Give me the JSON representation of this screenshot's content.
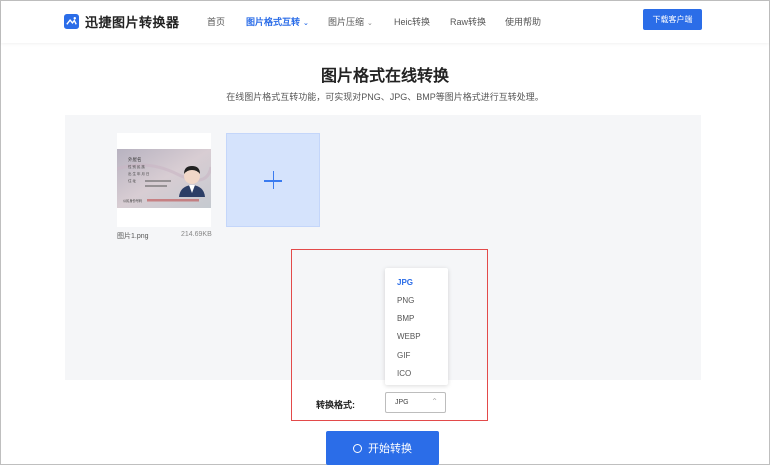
{
  "header": {
    "logo_text": "迅捷图片转换器",
    "nav": [
      {
        "label": "首页",
        "active": false,
        "has_dropdown": false
      },
      {
        "label": "图片格式互转",
        "active": true,
        "has_dropdown": true
      },
      {
        "label": "图片压缩",
        "active": false,
        "has_dropdown": true
      },
      {
        "label": "Heic转换",
        "active": false,
        "has_dropdown": false
      },
      {
        "label": "Raw转换",
        "active": false,
        "has_dropdown": false
      },
      {
        "label": "使用帮助",
        "active": false,
        "has_dropdown": false
      }
    ],
    "download_label": "下载客户端"
  },
  "main": {
    "title": "图片格式在线转换",
    "subtitle": "在线图片格式互转功能，可实现对PNG、JPG、BMP等图片格式进行互转处理。"
  },
  "upload": {
    "file_name": "图片1.png",
    "file_size": "214.69KB",
    "thumbnail_text": {
      "name": "外屋名",
      "line2": "性  别   民 族",
      "line3": "出  生   年   月   日",
      "line4": "住  址",
      "id_number": "公民身份号码"
    },
    "add_icon": "plus-icon"
  },
  "format": {
    "label": "转换格式:",
    "selected": "JPG",
    "options": [
      "JPG",
      "PNG",
      "BMP",
      "WEBP",
      "GIF",
      "ICO"
    ]
  },
  "start_button": {
    "label": "开始转换"
  },
  "colors": {
    "accent": "#2b6de8",
    "highlight": "#e34a4a",
    "add_tile_bg": "#d5e3fc"
  }
}
